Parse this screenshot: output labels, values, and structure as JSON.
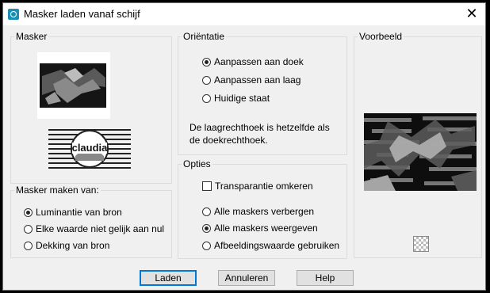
{
  "window": {
    "title": "Masker laden vanaf schijf",
    "close_glyph": "✕"
  },
  "masker_group": {
    "legend": "Masker",
    "logo_text": "claudia"
  },
  "maken_group": {
    "legend": "Masker maken van:",
    "options": [
      {
        "label": "Luminantie van bron",
        "selected": true
      },
      {
        "label": "Elke waarde niet gelijk aan nul",
        "selected": false
      },
      {
        "label": "Dekking van bron",
        "selected": false
      }
    ]
  },
  "orientatie_group": {
    "legend": "Oriëntatie",
    "options": [
      {
        "label": "Aanpassen aan doek",
        "selected": true
      },
      {
        "label": "Aanpassen aan laag",
        "selected": false
      },
      {
        "label": "Huidige staat",
        "selected": false
      }
    ],
    "note_line1": "De laagrechthoek is hetzelfde als",
    "note_line2": "de doekrechthoek."
  },
  "opties_group": {
    "legend": "Opties",
    "checkbox": {
      "label": "Transparantie omkeren",
      "checked": false
    },
    "options": [
      {
        "label": "Alle maskers verbergen",
        "selected": false
      },
      {
        "label": "Alle maskers weergeven",
        "selected": true
      },
      {
        "label": "Afbeeldingswaarde gebruiken",
        "selected": false
      }
    ]
  },
  "voorbeeld_group": {
    "legend": "Voorbeeld",
    "icon": "checkerboard-icon"
  },
  "buttons": {
    "ok": "Laden",
    "cancel": "Annuleren",
    "help": "Help"
  }
}
